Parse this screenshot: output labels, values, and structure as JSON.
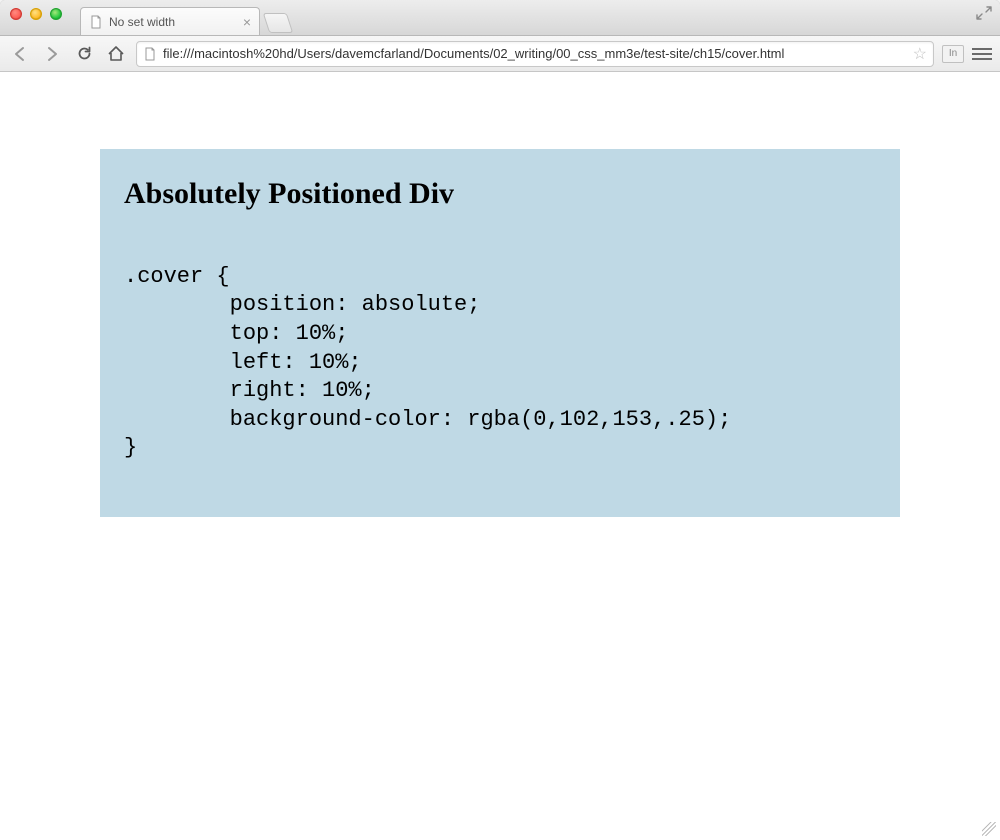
{
  "window": {
    "tab_title": "No set width",
    "maximize_tooltip": "Maximize"
  },
  "toolbar": {
    "url": "file:///macintosh%20hd/Users/davemcfarland/Documents/02_writing/00_css_mm3e/test-site/ch15/cover.html",
    "extension_label": "In"
  },
  "page": {
    "heading": "Absolutely Positioned Div",
    "code": ".cover {\n        position: absolute;\n        top: 10%;\n        left: 10%;\n        right: 10%;\n        background-color: rgba(0,102,153,.25);\n}"
  }
}
